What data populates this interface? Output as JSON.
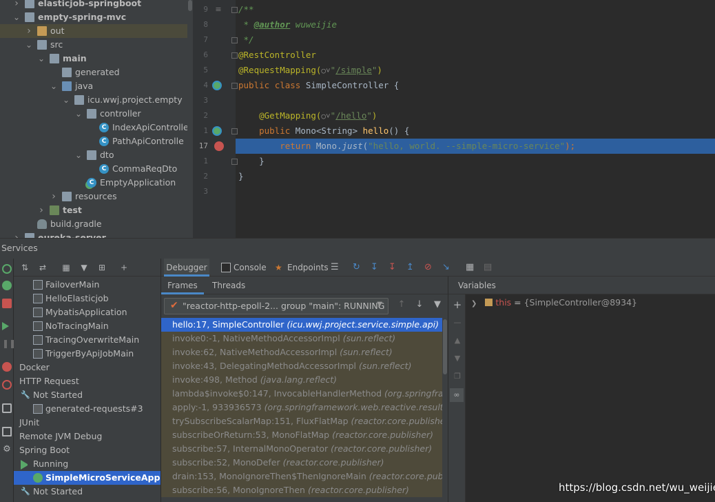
{
  "project_tree": {
    "items": [
      {
        "label": "elasticjob-springboot",
        "kind": "module",
        "bold": true,
        "expanded": false
      },
      {
        "label": "empty-spring-mvc",
        "kind": "module",
        "bold": true,
        "expanded": true
      },
      {
        "label": "out",
        "kind": "folder-excluded",
        "bold": false,
        "expanded": false
      },
      {
        "label": "src",
        "kind": "folder",
        "bold": false,
        "expanded": true
      },
      {
        "label": "main",
        "kind": "folder",
        "bold": true,
        "expanded": true
      },
      {
        "label": "generated",
        "kind": "folder-generated",
        "bold": false
      },
      {
        "label": "java",
        "kind": "folder-source",
        "bold": false,
        "expanded": true
      },
      {
        "label": "icu.wwj.project.empty",
        "kind": "package",
        "bold": false,
        "expanded": true
      },
      {
        "label": "controller",
        "kind": "package",
        "bold": false,
        "expanded": true
      },
      {
        "label": "IndexApiControlle",
        "kind": "class"
      },
      {
        "label": "PathApiControlle",
        "kind": "class"
      },
      {
        "label": "dto",
        "kind": "package",
        "bold": false,
        "expanded": true
      },
      {
        "label": "CommaReqDto",
        "kind": "class"
      },
      {
        "label": "EmptyApplication",
        "kind": "class-app"
      },
      {
        "label": "resources",
        "kind": "folder-resources",
        "bold": false,
        "expanded": false
      },
      {
        "label": "test",
        "kind": "folder-test",
        "bold": true,
        "expanded": false
      },
      {
        "label": "build.gradle",
        "kind": "gradle-file"
      },
      {
        "label": "eureka-server",
        "kind": "module",
        "bold": true
      }
    ]
  },
  "editor": {
    "lines": [
      {
        "num": "9",
        "text": "/**"
      },
      {
        "num": "8",
        "text": " * @author wuweijie"
      },
      {
        "num": "7",
        "text": " */"
      },
      {
        "num": "6",
        "text": "@RestController"
      },
      {
        "num": "5",
        "text": "@RequestMapping(\"/simple\")"
      },
      {
        "num": "4",
        "text": "public class SimpleController {"
      },
      {
        "num": "3",
        "text": ""
      },
      {
        "num": "2",
        "text": "    @GetMapping(\"/hello\")"
      },
      {
        "num": "1",
        "text": "    public Mono<String> hello() {"
      },
      {
        "num": "17",
        "text": "        return Mono.just(\"hello, world. --simple-micro-service\");"
      },
      {
        "num": "1",
        "text": "    }"
      },
      {
        "num": "2",
        "text": "}"
      },
      {
        "num": "3",
        "text": ""
      }
    ],
    "tokens": {
      "l0": "/**",
      "l1_pre": " * ",
      "l1_tag": "@author",
      "l1_name": " wuweijie",
      "l2": " */",
      "l3": "@RestController",
      "l4_ann": "@RequestMapping(",
      "l4_q1": "\"",
      "l4_path": "/simple",
      "l4_q2": "\"",
      "l4_close": ")",
      "l5_kw1": "public",
      "l5_kw2": "class",
      "l5_name": "SimpleController {",
      "l7_ann": "    @GetMapping(",
      "l7_q1": "\"",
      "l7_path": "/hello",
      "l7_q2": "\"",
      "l7_close": ")",
      "l8_kw": "    public",
      "l8_rest": " Mono<String> ",
      "l8_name": "hello",
      "l8_end": "() {",
      "l9_kw": "        return",
      "l9_obj": " Mono.",
      "l9_fn": "just",
      "l9_open": "(",
      "l9_str": "\"hello, world. --simple-micro-service\"",
      "l9_end": ");",
      "l10": "    }",
      "l11": "}"
    }
  },
  "services": {
    "title": "Services",
    "tree": [
      {
        "label": "FailoverMain",
        "kind": "app",
        "indent": 2
      },
      {
        "label": "HelloElasticjob",
        "kind": "app",
        "indent": 2
      },
      {
        "label": "MybatisApplication",
        "kind": "app",
        "indent": 2
      },
      {
        "label": "NoTracingMain",
        "kind": "app",
        "indent": 2
      },
      {
        "label": "TracingOverwriteMain",
        "kind": "app",
        "indent": 2
      },
      {
        "label": "TriggerByApiJobMain",
        "kind": "app",
        "indent": 2
      },
      {
        "label": "Docker",
        "kind": "group",
        "indent": 0
      },
      {
        "label": "HTTP Request",
        "kind": "group",
        "indent": 0
      },
      {
        "label": "Not Started",
        "kind": "status-not-started",
        "indent": 1
      },
      {
        "label": "generated-requests#3",
        "kind": "http-file",
        "indent": 2
      },
      {
        "label": "JUnit",
        "kind": "group",
        "indent": 0
      },
      {
        "label": "Remote JVM Debug",
        "kind": "group",
        "indent": 0
      },
      {
        "label": "Spring Boot",
        "kind": "group",
        "indent": 0
      },
      {
        "label": "Running",
        "kind": "status-running",
        "indent": 1
      },
      {
        "label": "SimpleMicroServiceApplica",
        "kind": "app-debug",
        "indent": 2,
        "selected": true
      },
      {
        "label": "Not Started",
        "kind": "status-not-started",
        "indent": 1
      }
    ]
  },
  "debugger": {
    "tabs": [
      {
        "label": "Debugger",
        "active": true
      },
      {
        "label": "Console",
        "active": false
      },
      {
        "label": "Endpoints",
        "active": false
      }
    ],
    "subtabs": {
      "frames": "Frames",
      "threads": "Threads",
      "variables": "Variables"
    },
    "thread_selector": "\"reactor-http-epoll-2... group \"main\": RUNNING",
    "frames": [
      {
        "method": "hello:17, SimpleController",
        "pkg": "(icu.wwj.project.service.simple.api)",
        "selected": true
      },
      {
        "method": "invoke0:-1, NativeMethodAccessorImpl",
        "pkg": "(sun.reflect)"
      },
      {
        "method": "invoke:62, NativeMethodAccessorImpl",
        "pkg": "(sun.reflect)"
      },
      {
        "method": "invoke:43, DelegatingMethodAccessorImpl",
        "pkg": "(sun.reflect)"
      },
      {
        "method": "invoke:498, Method",
        "pkg": "(java.lang.reflect)"
      },
      {
        "method": "lambda$invoke$0:147, InvocableHandlerMethod",
        "pkg": "(org.springframewo"
      },
      {
        "method": "apply:-1, 933936573",
        "pkg": "(org.springframework.web.reactive.result.method"
      },
      {
        "method": "trySubscribeScalarMap:151, FluxFlatMap",
        "pkg": "(reactor.core.publisher)"
      },
      {
        "method": "subscribeOrReturn:53, MonoFlatMap",
        "pkg": "(reactor.core.publisher)"
      },
      {
        "method": "subscribe:57, InternalMonoOperator",
        "pkg": "(reactor.core.publisher)"
      },
      {
        "method": "subscribe:52, MonoDefer",
        "pkg": "(reactor.core.publisher)"
      },
      {
        "method": "drain:153, MonoIgnoreThen$ThenIgnoreMain",
        "pkg": "(reactor.core.publisher)"
      },
      {
        "method": "subscribe:56, MonoIgnoreThen",
        "pkg": "(reactor.core.publisher)"
      }
    ],
    "variables": [
      {
        "name": "this",
        "eq": " = ",
        "value": "{SimpleController@8934}"
      }
    ]
  },
  "watermark": "https://blog.csdn.net/wu_weijie",
  "colors": {
    "selection": "#2f65ca",
    "highlight_line": "#2d5f9e",
    "running": "#59a869",
    "breakpoint": "#c75450"
  }
}
